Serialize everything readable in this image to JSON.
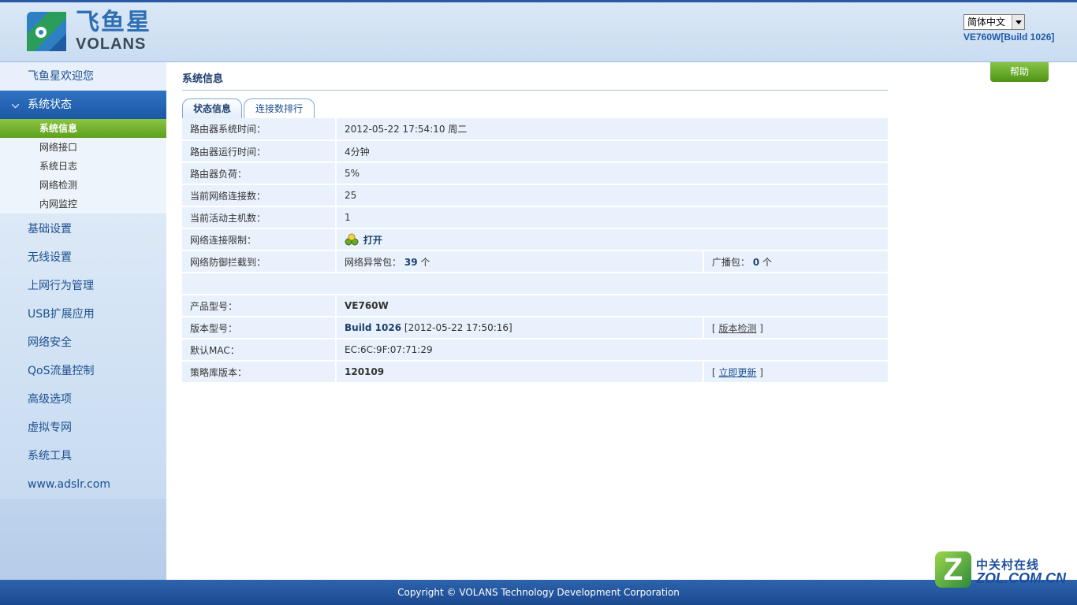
{
  "header": {
    "logo_cn": "飞鱼星",
    "logo_en": "VOLANS",
    "language": "简体中文",
    "build": "VE760W[Build 1026]"
  },
  "sidebar": {
    "welcome": "飞鱼星欢迎您",
    "active_group": "系统状态",
    "sub_items": [
      "系统信息",
      "网络接口",
      "系统日志",
      "网络检测",
      "内网监控"
    ],
    "items": [
      "基础设置",
      "无线设置",
      "上网行为管理",
      "USB扩展应用",
      "网络安全",
      "QoS流量控制",
      "高级选项",
      "虚拟专网",
      "系统工具",
      "www.adslr.com"
    ]
  },
  "main": {
    "title": "系统信息",
    "help": "帮助",
    "tabs": [
      "状态信息",
      "连接数排行"
    ],
    "rows": {
      "sys_time_label": "路由器系统时间：",
      "sys_time": "2012-05-22 17:54:10 周二",
      "uptime_label": "路由器运行时间：",
      "uptime": "4分钟",
      "load_label": "路由器负荷：",
      "load": "5%",
      "conn_label": "当前网络连接数：",
      "conn": "25",
      "hosts_label": "当前活动主机数：",
      "hosts": "1",
      "limit_label": "网络连接限制：",
      "limit": "打开",
      "defense_label": "网络防御拦截到：",
      "abnormal_label": "网络异常包：",
      "abnormal_count": "39",
      "abnormal_unit": "个",
      "broadcast_label": "广播包：",
      "broadcast_count": "0",
      "broadcast_unit": "个",
      "model_label": "产品型号：",
      "model": "VE760W",
      "version_label": "版本型号：",
      "version_build": "Build 1026",
      "version_date": "[2012-05-22 17:50:16]",
      "version_check": "版本检测",
      "mac_label": "默认MAC：",
      "mac": "EC:6C:9F:07:71:29",
      "policy_label": "策略库版本：",
      "policy": "120109",
      "policy_update": "立即更新"
    }
  },
  "footer": {
    "copyright": "Copyright © VOLANS Technology Development Corporation"
  },
  "watermark": {
    "cn": "中关村在线",
    "en": "ZOL.COM.CN",
    "z": "Z"
  },
  "colors": {
    "accent_blue": "#1e5aa8",
    "active_green": "#5ea01f",
    "row_bg": "#e9f2fc"
  }
}
